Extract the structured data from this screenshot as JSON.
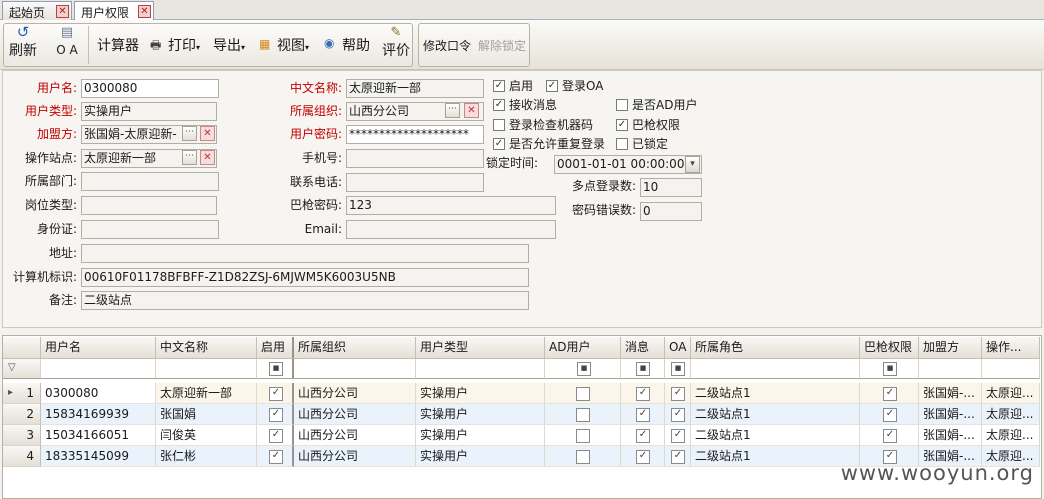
{
  "tabs": [
    {
      "label": "起始页"
    },
    {
      "label": "用户权限"
    }
  ],
  "toolbar": {
    "refresh": "刷新",
    "oa": "O A",
    "calculator": "计算器",
    "print": "打印",
    "export": "导出",
    "view": "视图",
    "help": "帮助",
    "evaluate": "评价",
    "change_password": "修改口令",
    "unlock": "解除锁定"
  },
  "form": {
    "username_label": "用户名:",
    "username": "0300080",
    "usertype_label": "用户类型:",
    "usertype": "实操用户",
    "franchise_label": "加盟方:",
    "franchise": "张国娟-太原迎新-",
    "station_label": "操作站点:",
    "station": "太原迎新一部",
    "dept_label": "所属部门:",
    "dept": "",
    "position_label": "岗位类型:",
    "position": "",
    "idcard_label": "身份证:",
    "idcard": "",
    "address_label": "地址:",
    "address": "",
    "machine_label": "计算机标识:",
    "machine": "00610F01178BFBFF-Z1D82ZSJ-6MJWM5K6003U5NB",
    "remark_label": "备注:",
    "remark": "二级站点",
    "cnname_label": "中文名称:",
    "cnname": "太原迎新一部",
    "org_label": "所属组织:",
    "org": "山西分公司",
    "password_label": "用户密码:",
    "password": "********************",
    "mobile_label": "手机号:",
    "mobile": "",
    "phone_label": "联系电话:",
    "phone": "",
    "scanpwd_label": "巴枪密码:",
    "scanpwd": "123",
    "email_label": "Email:",
    "email": "",
    "enable_label": "启用",
    "loginoa_label": "登录OA",
    "receive_label": "接收消息",
    "isad_label": "是否AD用户",
    "checkmachine_label": "登录检查机器码",
    "scanperm_label": "巴枪权限",
    "allowrepeat_label": "是否允许重复登录",
    "locked_label": "已锁定",
    "locktime_label": "锁定时间:",
    "locktime": "0001-01-01 00:00:00",
    "multilogin_label": "多点登录数:",
    "multilogin": "10",
    "pwderr_label": "密码错误数:",
    "pwderr": "0"
  },
  "grid": {
    "columns": [
      "用户名",
      "中文名称",
      "启用",
      "所属组织",
      "用户类型",
      "AD用户",
      "消息",
      "OA",
      "所属角色",
      "巴枪权限",
      "加盟方",
      "操作..."
    ],
    "rows": [
      {
        "no": "1",
        "user": "0300080",
        "cn": "太原迎新一部",
        "org": "山西分公司",
        "type": "实操用户",
        "role": "二级站点1",
        "fr": "张国娟-...",
        "op": "太原迎..."
      },
      {
        "no": "2",
        "user": "15834169939",
        "cn": "张国娟",
        "org": "山西分公司",
        "type": "实操用户",
        "role": "二级站点1",
        "fr": "张国娟-...",
        "op": "太原迎..."
      },
      {
        "no": "3",
        "user": "15034166051",
        "cn": "闫俊英",
        "org": "山西分公司",
        "type": "实操用户",
        "role": "二级站点1",
        "fr": "张国娟-...",
        "op": "太原迎..."
      },
      {
        "no": "4",
        "user": "18335145099",
        "cn": "张仁彬",
        "org": "山西分公司",
        "type": "实操用户",
        "role": "二级站点1",
        "fr": "张国娟-...",
        "op": "太原迎..."
      }
    ]
  },
  "watermark": "www.wooyun.org"
}
